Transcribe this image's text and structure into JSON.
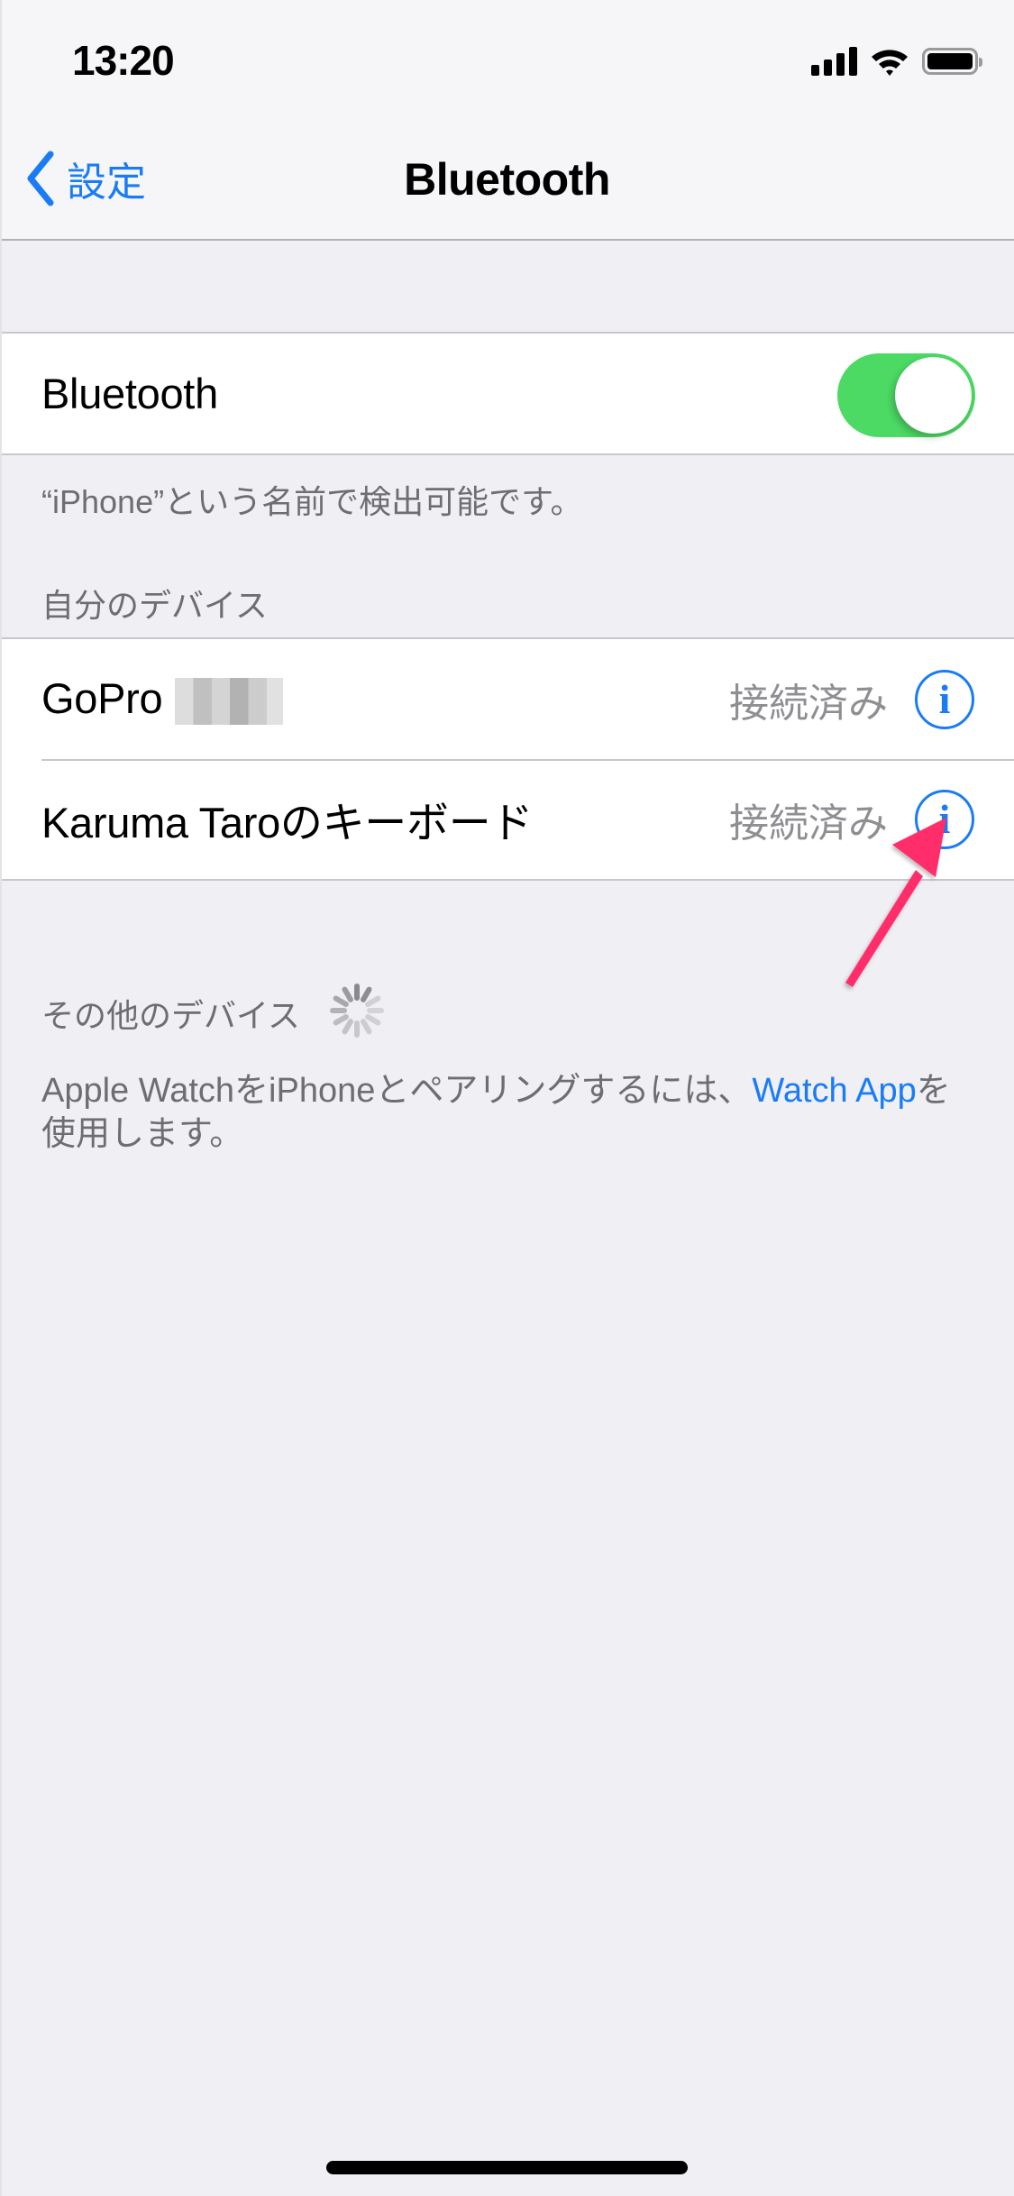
{
  "status_bar": {
    "time": "13:20",
    "icons": [
      "cellular-signal-icon",
      "wifi-icon",
      "battery-icon"
    ]
  },
  "nav": {
    "back_label": "設定",
    "back_icon": "chevron-left-icon",
    "title": "Bluetooth"
  },
  "bluetooth_toggle": {
    "label": "Bluetooth",
    "state": "on",
    "on_color": "#4cd964"
  },
  "discoverable_note": "“iPhone”という名前で検出可能です。",
  "my_devices": {
    "header": "自分のデバイス",
    "items": [
      {
        "name": "GoPro",
        "name_suffix_redacted": true,
        "status": "接続済み",
        "info_icon": "info-icon"
      },
      {
        "name": "Karuma Taroのキーボード",
        "name_suffix_redacted": false,
        "status": "接続済み",
        "info_icon": "info-icon"
      }
    ]
  },
  "other_devices": {
    "header": "その他のデバイス",
    "loading_icon": "activity-spinner-icon"
  },
  "apple_watch_note": {
    "text_before": "Apple WatchをiPhoneとペアリングするには、",
    "link": "Watch App",
    "text_after": "を使用します。"
  },
  "annotation": {
    "arrow_color": "#ff2d6b",
    "points_to": "Karuma Taroのキーボード info button"
  },
  "colors": {
    "accent": "#1a7cf5",
    "background": "#efeff4",
    "secondary_text": "#8e8e93"
  }
}
